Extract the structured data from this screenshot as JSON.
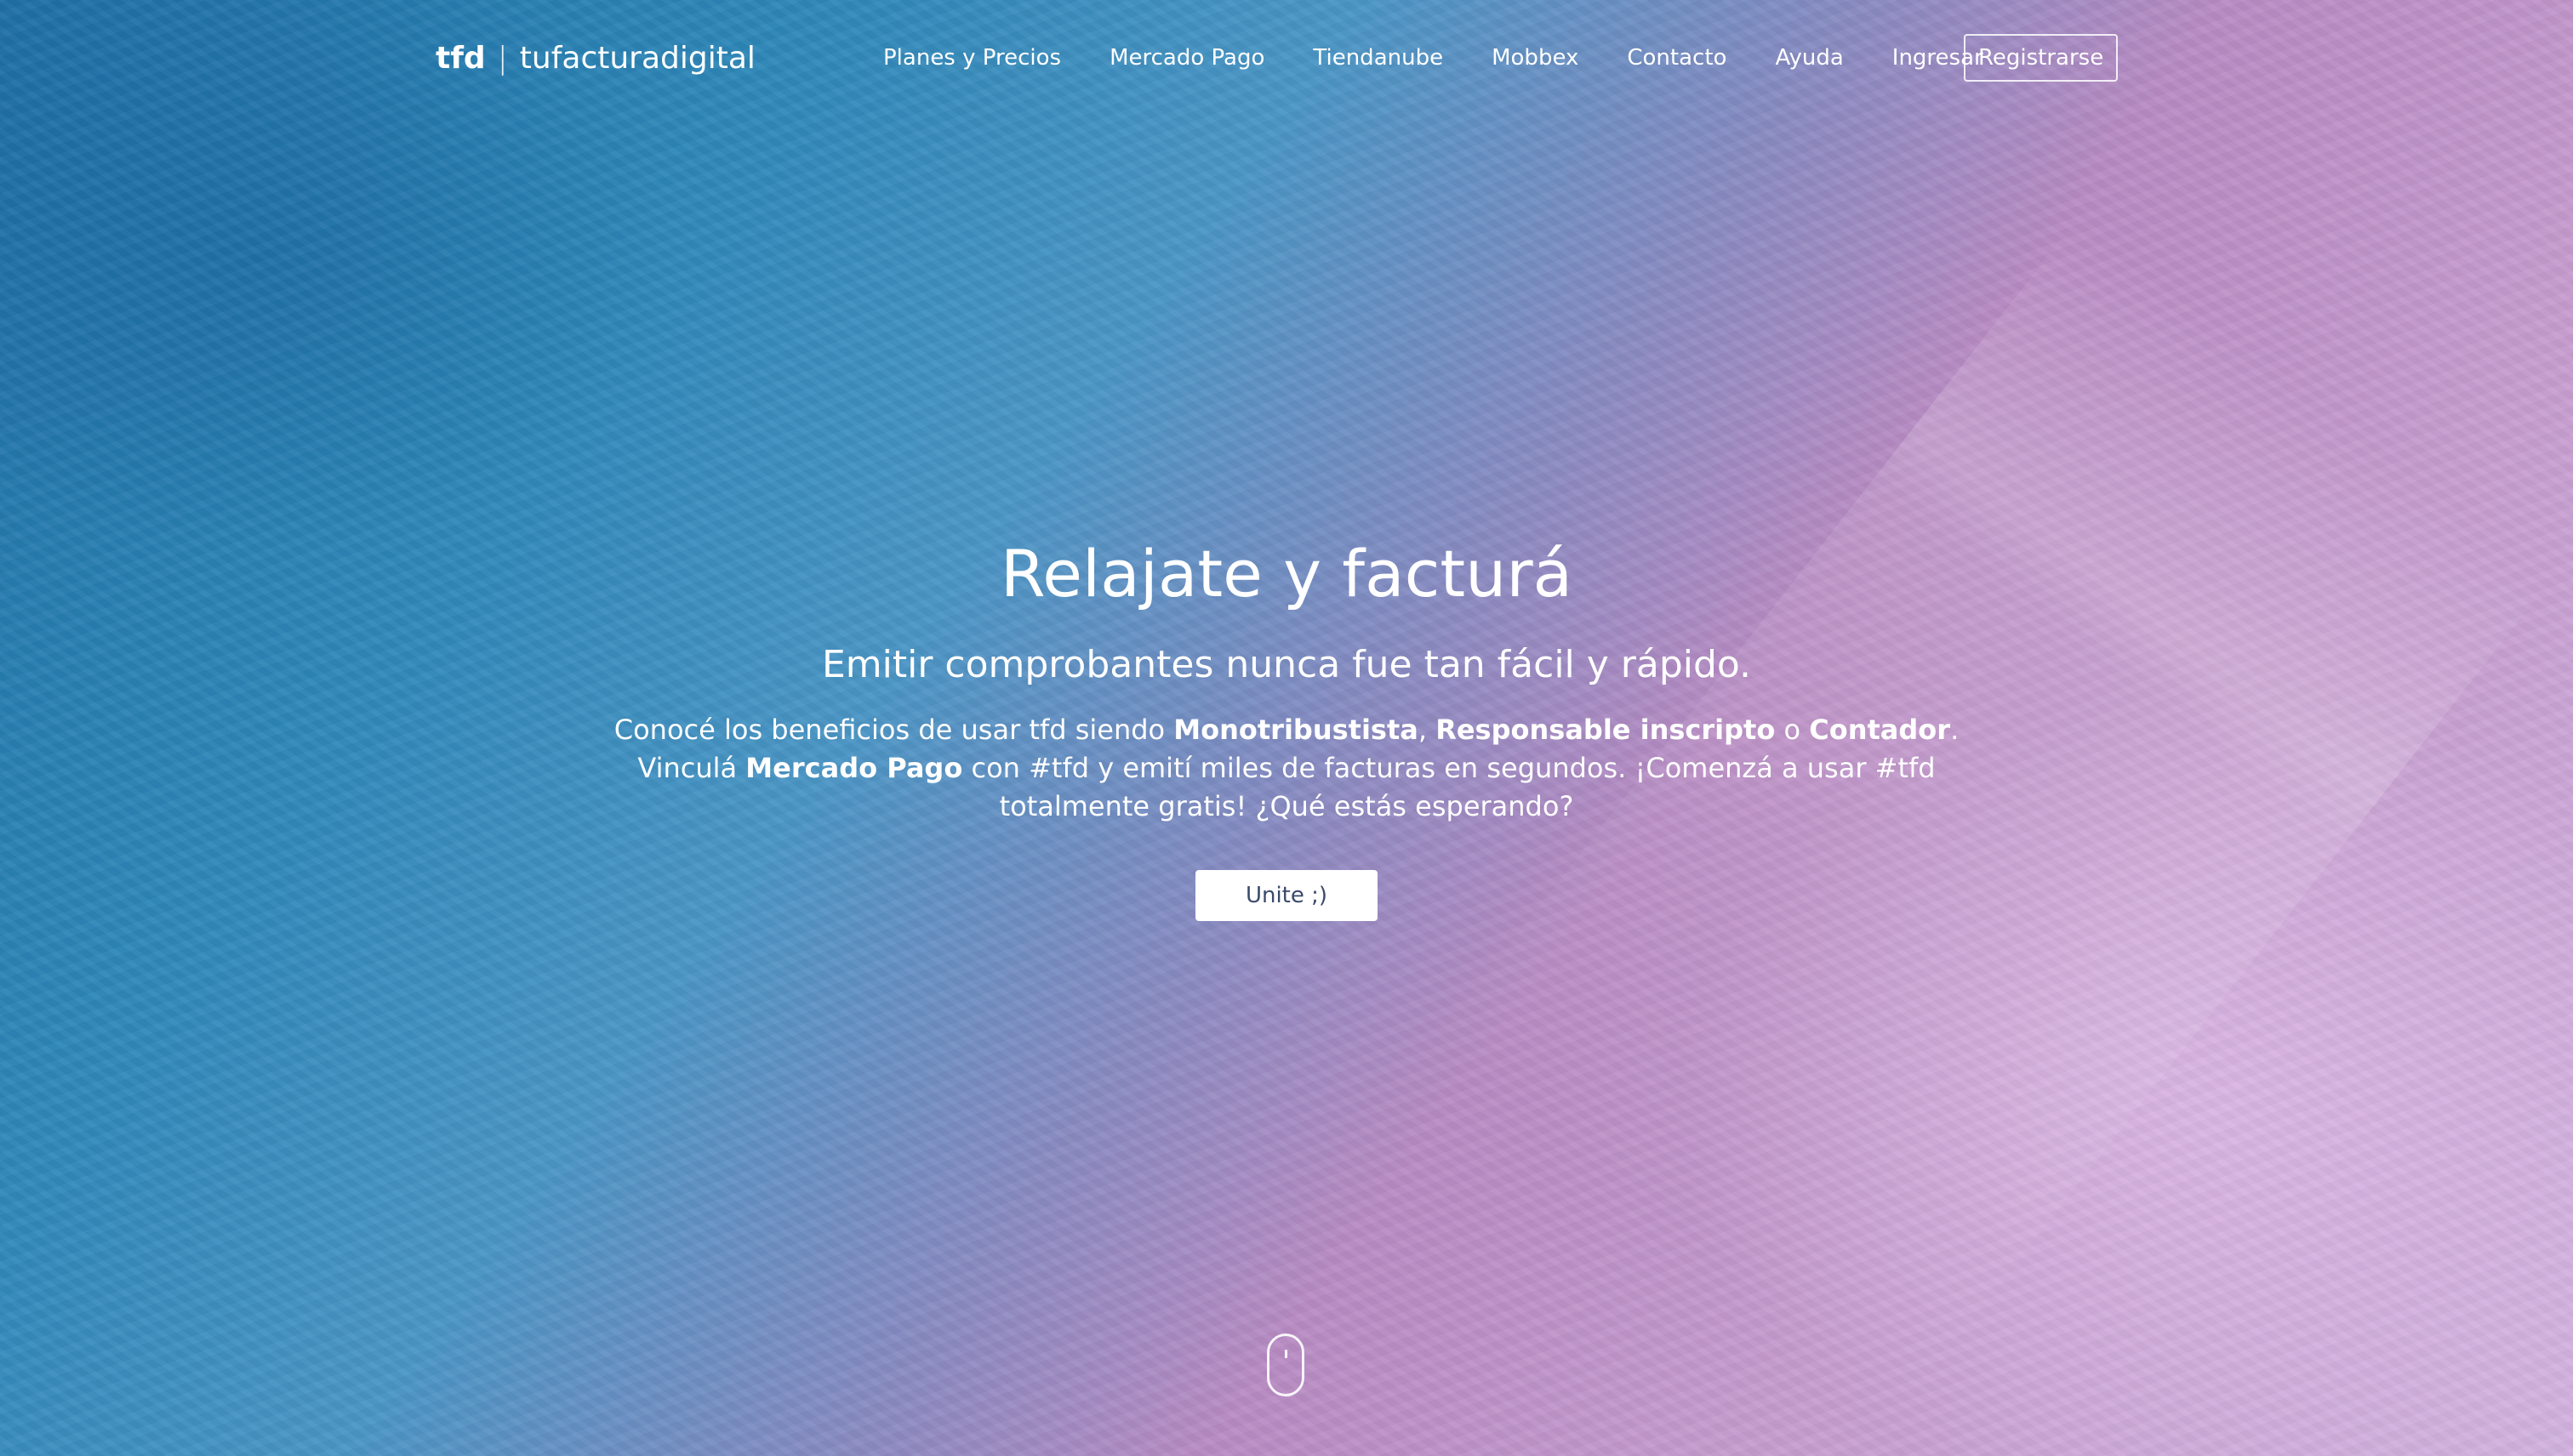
{
  "brand": {
    "short": "tfd",
    "separator": "|",
    "name": "tufacturadigital"
  },
  "nav": {
    "items": [
      {
        "label": "Planes y Precios"
      },
      {
        "label": "Mercado Pago"
      },
      {
        "label": "Tiendanube"
      },
      {
        "label": "Mobbex"
      },
      {
        "label": "Contacto"
      },
      {
        "label": "Ayuda"
      },
      {
        "label": "Ingresar"
      }
    ],
    "register_label": "Registrarse"
  },
  "hero": {
    "headline": "Relajate y facturá",
    "subheadline": "Emitir comprobantes nunca fue tan fácil y rápido.",
    "description": {
      "t1": "Conocé los beneficios de usar tfd siendo ",
      "b1": "Monotribustista",
      "t2": ", ",
      "b2": "Responsable inscripto",
      "t3": " o ",
      "b3": "Contador",
      "t4": ". Vinculá ",
      "b4": "Mercado Pago",
      "t5": " con #tfd y emití miles de facturas en segundos. ¡Comenzá a usar #tfd totalmente gratis! ¿Qué estás esperando?"
    },
    "cta_label": "Unite ;)"
  },
  "scroll_indicator": {
    "icon": "mouse-scroll-icon"
  },
  "colors": {
    "background_blue": "#2d87b8",
    "background_pink": "#c79ed0",
    "text": "#ffffff",
    "cta_text": "#3b4a6a"
  }
}
